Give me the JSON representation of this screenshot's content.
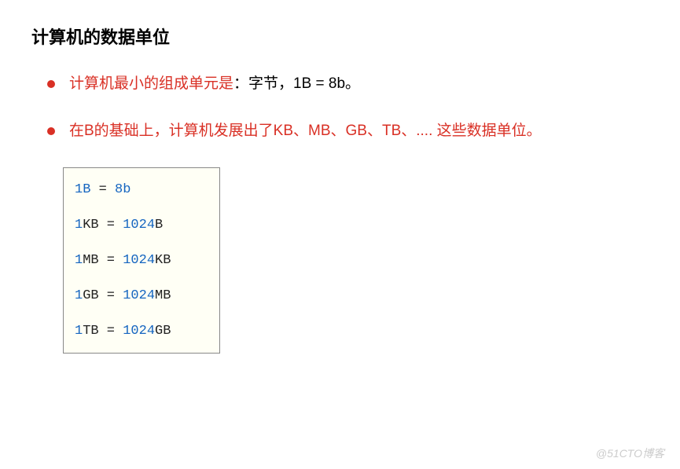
{
  "title": "计算机的数据单位",
  "bullets": [
    {
      "red_prefix": "计算机最小的组成单元是",
      "black_suffix": "：字节，1B = 8b。"
    },
    {
      "red_prefix": "在B的基础上，计算机发展出了KB、MB、GB、TB、.... 这些数据单位。",
      "black_suffix": ""
    }
  ],
  "code": {
    "lines": [
      {
        "p1": "1B",
        "p2": "  = ",
        "p3": "8b",
        "p4": ""
      },
      {
        "p1": "1",
        "p2": "KB  = ",
        "p3": "1024",
        "p4": "B"
      },
      {
        "p1": "1",
        "p2": "MB  = ",
        "p3": "1024",
        "p4": "KB"
      },
      {
        "p1": "1",
        "p2": "GB  = ",
        "p3": "1024",
        "p4": "MB"
      },
      {
        "p1": "1",
        "p2": "TB  = ",
        "p3": "1024",
        "p4": "GB"
      }
    ]
  },
  "watermark": "@51CTO博客"
}
